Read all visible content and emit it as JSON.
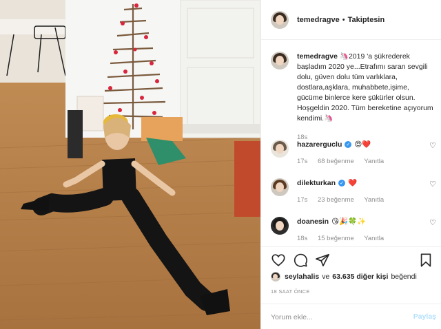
{
  "post": {
    "author": "temedragve",
    "separator": "•",
    "follow_status": "Takiptesin"
  },
  "caption": {
    "username": "temedragve",
    "text": "🦄2019 'a şükrederek başladım 2020 ye...Etrafımı saran sevgili dolu, güven dolu tüm varlıklara, dostlara,aşklara, muhabbete,işime, gücüme binlerce kere şükürler olsun. Hoşgeldin 2020. Tüm bereketine açıyorum kendimi.🦄",
    "time": "18s"
  },
  "comments": [
    {
      "username": "hazarerguclu",
      "verified": true,
      "text": "😍❤️",
      "time": "17s",
      "likes": "68 beğenme",
      "reply": "Yanıtla"
    },
    {
      "username": "dilekturkan",
      "verified": true,
      "text": "❤️",
      "time": "17s",
      "likes": "23 beğenme",
      "reply": "Yanıtla"
    },
    {
      "username": "doanesin",
      "verified": false,
      "text": "😘🎉🍀✨",
      "time": "18s",
      "likes": "15 beğenme",
      "reply": "Yanıtla"
    }
  ],
  "likes": {
    "first_user": "seylahalis",
    "connector": "ve",
    "others": "63.635 diğer kişi",
    "verb": "beğendi"
  },
  "timestamp": "18 SAAT ÖNCE",
  "comment_box": {
    "placeholder": "Yorum ekle...",
    "post_label": "Paylaş"
  },
  "icons": [
    "heart-icon",
    "comment-icon",
    "share-icon",
    "bookmark-icon"
  ],
  "colors": {
    "verified": "#3897f0",
    "post_disabled": "#b2dffc",
    "muted": "#8e8e8e",
    "floor": "#b9834c"
  }
}
